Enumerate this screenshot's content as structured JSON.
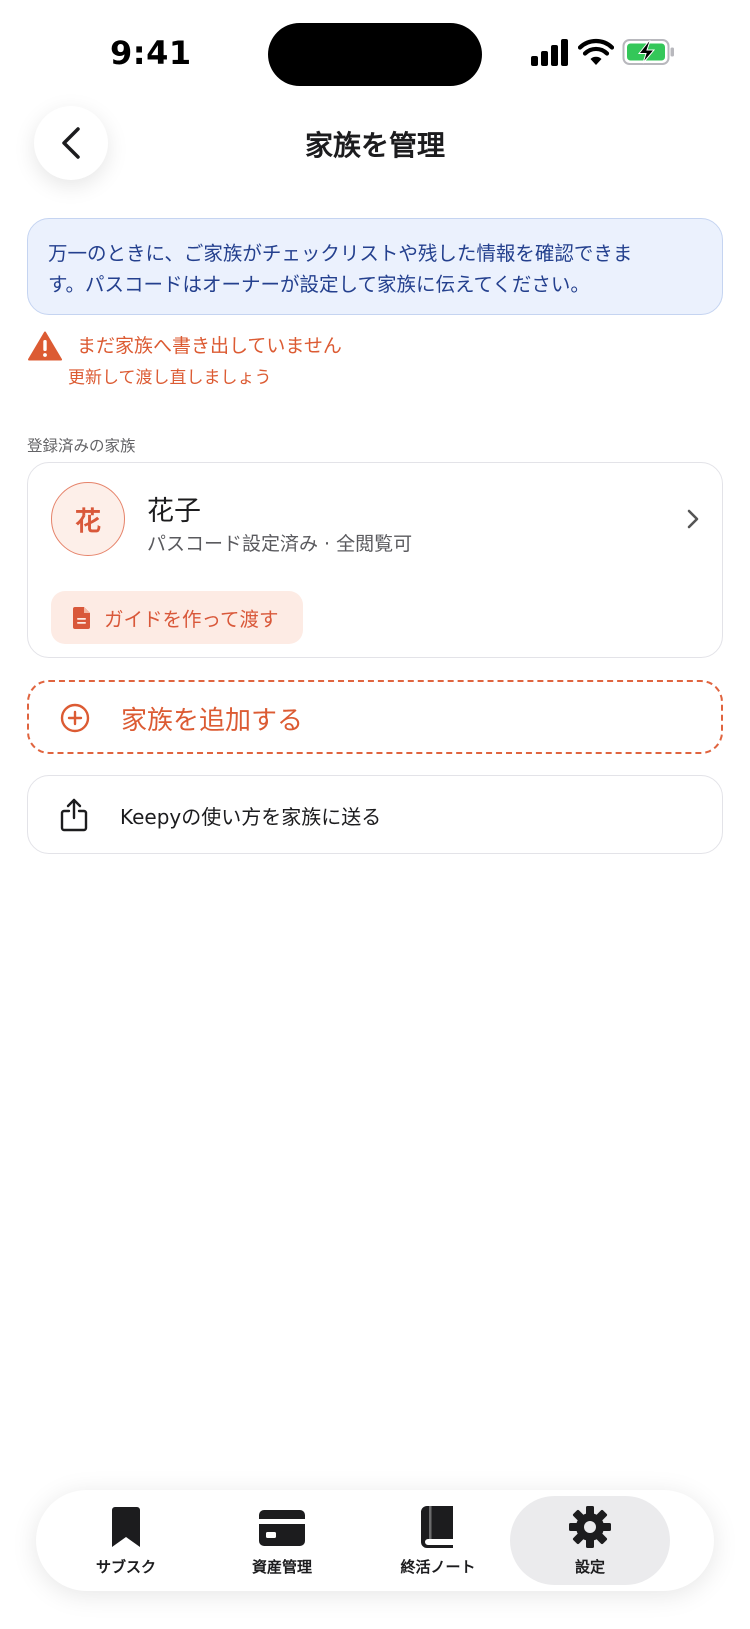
{
  "status_bar": {
    "time": "9:41"
  },
  "header": {
    "title": "家族を管理",
    "back_icon": "chevron-left-icon"
  },
  "info_box": {
    "line1": "万一のときに、ご家族がチェックリストや残した情報を確認できま",
    "line2": "す。パスコードはオーナーが設定して家族に伝えてください。"
  },
  "warning": {
    "icon": "warning-triangle-icon",
    "title": "まだ家族へ書き出していません",
    "subtitle": "更新して渡し直しましょう"
  },
  "family_section": {
    "label": "登録済みの家族",
    "members": [
      {
        "avatar_text": "花",
        "name": "花子",
        "status": "パスコード設定済み · 全閲覧可",
        "guide_button_label": "ガイドを作って渡す"
      }
    ]
  },
  "add_family": {
    "label": "家族を追加する",
    "icon": "plus-circle-icon"
  },
  "share_howto": {
    "label": "Keepyの使い方を家族に送る",
    "icon": "share-icon"
  },
  "tab_bar": {
    "tabs": [
      {
        "label": "サブスク",
        "icon": "bookmark-icon",
        "active": false
      },
      {
        "label": "資産管理",
        "icon": "credit-card-icon",
        "active": false
      },
      {
        "label": "終活ノート",
        "icon": "book-icon",
        "active": false
      },
      {
        "label": "設定",
        "icon": "gear-icon",
        "active": true
      }
    ]
  },
  "colors": {
    "accent": "#dc5b33",
    "info_bg": "#ebf1fd",
    "info_text": "#24408e",
    "battery_green": "#34c759"
  }
}
